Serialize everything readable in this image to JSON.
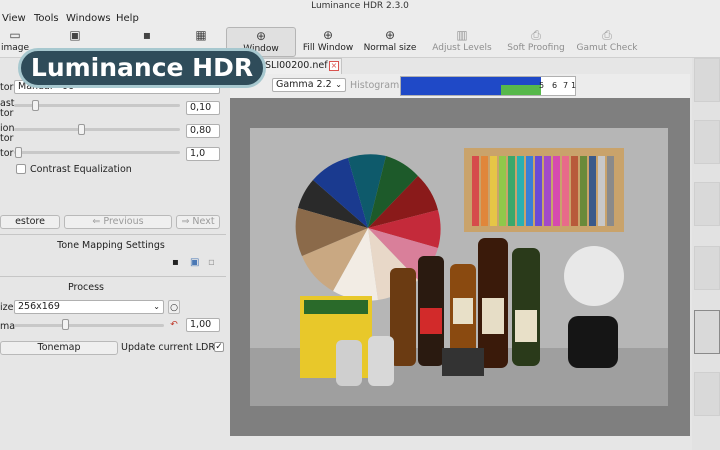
{
  "window": {
    "title": "Luminance HDR 2.3.0"
  },
  "menu": {
    "items": [
      "View",
      "Tools",
      "Windows",
      "Help"
    ]
  },
  "toolbar": {
    "image_label": "image",
    "window_label": "Window",
    "fill_window": "Fill Window",
    "normal_size": "Normal size",
    "adjust_levels": "Adjust Levels",
    "soft_proofing": "Soft Proofing",
    "gamut_check": "Gamut Check"
  },
  "overlay": {
    "text": "Luminance HDR"
  },
  "tab": {
    "filename": "SLI00200.nef"
  },
  "viewer": {
    "gamma_select": "Gamma 2.2",
    "histogram_label": "Histogram",
    "histogram_ticks": [
      "5",
      "6",
      "7",
      "1"
    ]
  },
  "params": {
    "mode_label": "tor",
    "mode_value": "Manual - 06",
    "contrast_label_1": "ast",
    "contrast_label_2": "tor",
    "contrast_value": "0,10",
    "saturation_label_1": "ion",
    "saturation_label_2": "tor",
    "saturation_value": "0,80",
    "detail_label": "tor",
    "detail_value": "1,0",
    "contrast_eq_label": "Contrast Equalization"
  },
  "nav": {
    "restore": "estore",
    "previous": "Previous",
    "next": "Next"
  },
  "settings": {
    "title": "Tone Mapping Settings"
  },
  "process": {
    "title": "Process",
    "size_label": "ize",
    "size_value": "256x169",
    "gamma_label": "ma",
    "gamma_value": "1,00",
    "tonemap_button": "Tonemap",
    "update_label": "Update current LDR",
    "update_checked": "✓"
  }
}
